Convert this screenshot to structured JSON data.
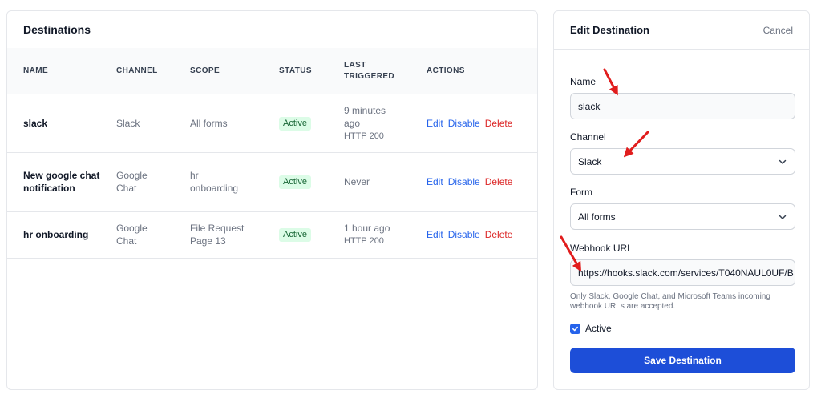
{
  "destinations": {
    "title": "Destinations",
    "columns": [
      "NAME",
      "CHANNEL",
      "SCOPE",
      "STATUS",
      "LAST TRIGGERED",
      "ACTIONS"
    ],
    "rows": [
      {
        "name": "slack",
        "channel": "Slack",
        "scope": "All forms",
        "status": "Active",
        "last": "9 minutes ago",
        "last_sub": "HTTP 200",
        "actions": [
          "Edit",
          "Disable",
          "Delete"
        ]
      },
      {
        "name": "New google chat notification",
        "channel": "Google Chat",
        "scope": "hr onboarding",
        "status": "Active",
        "last": "Never",
        "last_sub": "",
        "actions": [
          "Edit",
          "Disable",
          "Delete"
        ]
      },
      {
        "name": "hr onboarding",
        "channel": "Google Chat",
        "scope": "File Request Page 13",
        "status": "Active",
        "last": "1 hour ago",
        "last_sub": "HTTP 200",
        "actions": [
          "Edit",
          "Disable",
          "Delete"
        ]
      }
    ]
  },
  "edit": {
    "title": "Edit Destination",
    "cancel": "Cancel",
    "name_label": "Name",
    "name_value": "slack",
    "channel_label": "Channel",
    "channel_value": "Slack",
    "form_label": "Form",
    "form_value": "All forms",
    "webhook_label": "Webhook URL",
    "webhook_value": "https://hooks.slack.com/services/T040NAUL0UF/B",
    "help": "Only Slack, Google Chat, and Microsoft Teams incoming webhook URLs are accepted.",
    "active_label": "Active",
    "save": "Save Destination"
  },
  "colors": {
    "primary": "#1d4ed8",
    "link": "#2563eb",
    "danger": "#dc2626",
    "badge_bg": "#dcfce7",
    "badge_text": "#166534",
    "annotation": "#e11d1d"
  }
}
